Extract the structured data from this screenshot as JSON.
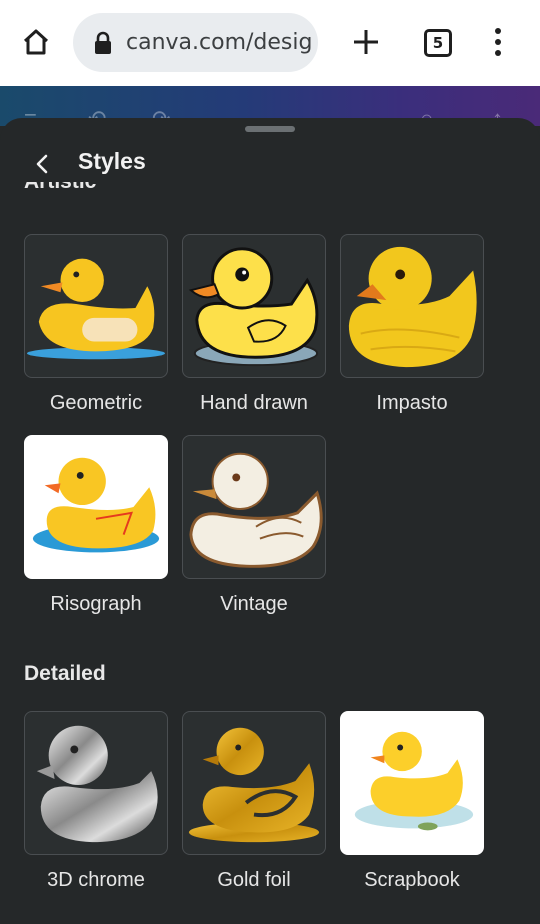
{
  "browser": {
    "url": "canva.com/desig",
    "tab_count": "5",
    "icons": [
      "home-icon",
      "lock-icon",
      "plus-icon",
      "tabs-icon",
      "more-vert-icon"
    ]
  },
  "sheet": {
    "title": "Styles",
    "back_icon": "chevron-left-icon",
    "clipped_section": "Artistic"
  },
  "sections": {
    "artistic": {
      "items": [
        {
          "label": "Geometric"
        },
        {
          "label": "Hand drawn"
        },
        {
          "label": "Impasto"
        },
        {
          "label": "Risograph"
        },
        {
          "label": "Vintage"
        }
      ]
    },
    "detailed": {
      "title": "Detailed",
      "items": [
        {
          "label": "3D chrome"
        },
        {
          "label": "Gold foil"
        },
        {
          "label": "Scrapbook"
        }
      ]
    }
  },
  "colors": {
    "sheet_bg": "#252829",
    "duck_yellow": "#f7c520",
    "beak_orange": "#f08a24"
  }
}
